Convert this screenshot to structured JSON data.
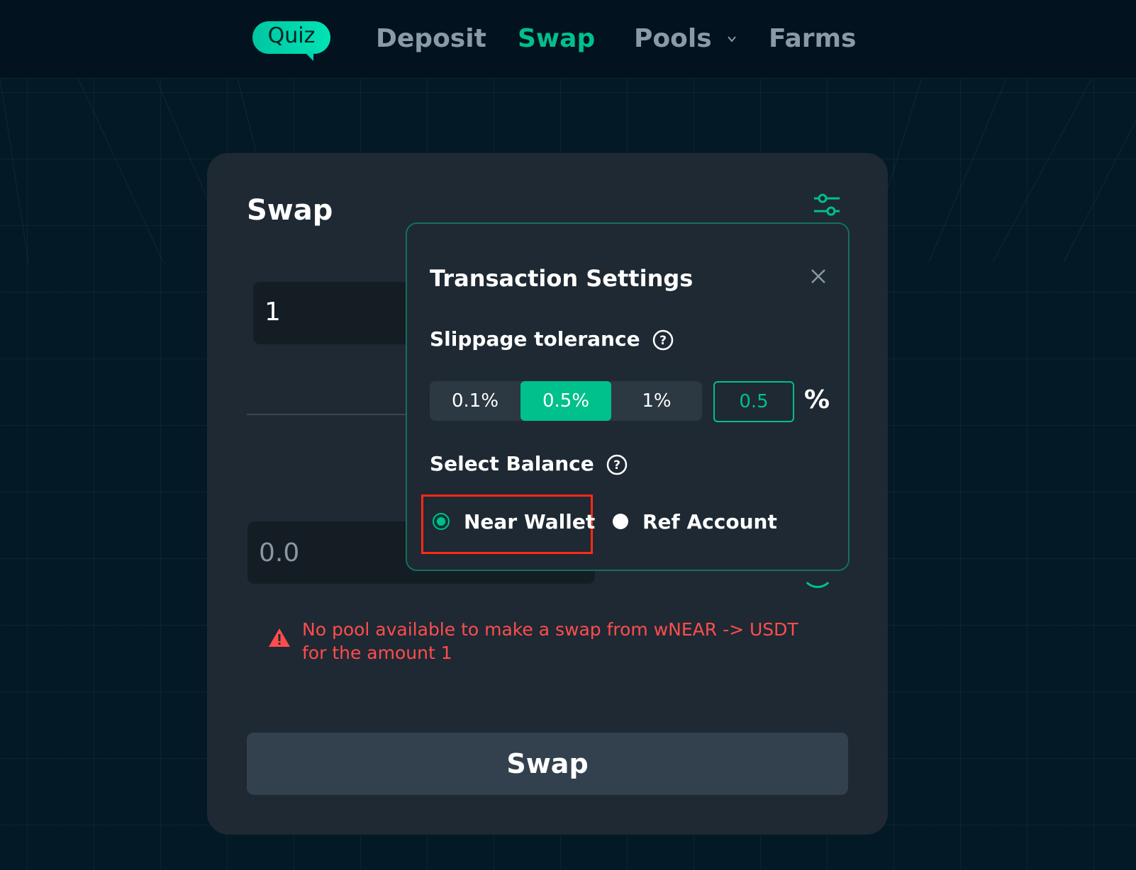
{
  "nav": {
    "quiz": "Quiz",
    "items": [
      "Deposit",
      "Swap",
      "Pools",
      "Farms"
    ],
    "active": "Swap"
  },
  "swap": {
    "title": "Swap",
    "from_amount": "1",
    "to_amount": "0.0",
    "error": "No pool available to make a swap from wNEAR -> USDT for the amount 1",
    "button": "Swap"
  },
  "settings": {
    "title": "Transaction Settings",
    "slippage_label": "Slippage tolerance",
    "slippage_options": [
      "0.1%",
      "0.5%",
      "1%"
    ],
    "slippage_selected": "0.5%",
    "slippage_value": "0.5",
    "percent": "%",
    "balance_label": "Select Balance",
    "balance_options": [
      "Near Wallet",
      "Ref Account"
    ],
    "balance_selected": "Near Wallet"
  },
  "colors": {
    "accent": "#00c08b",
    "error": "#ff4d4d",
    "highlight": "#ff2a16",
    "card": "#1e2933",
    "background": "#02121f"
  }
}
